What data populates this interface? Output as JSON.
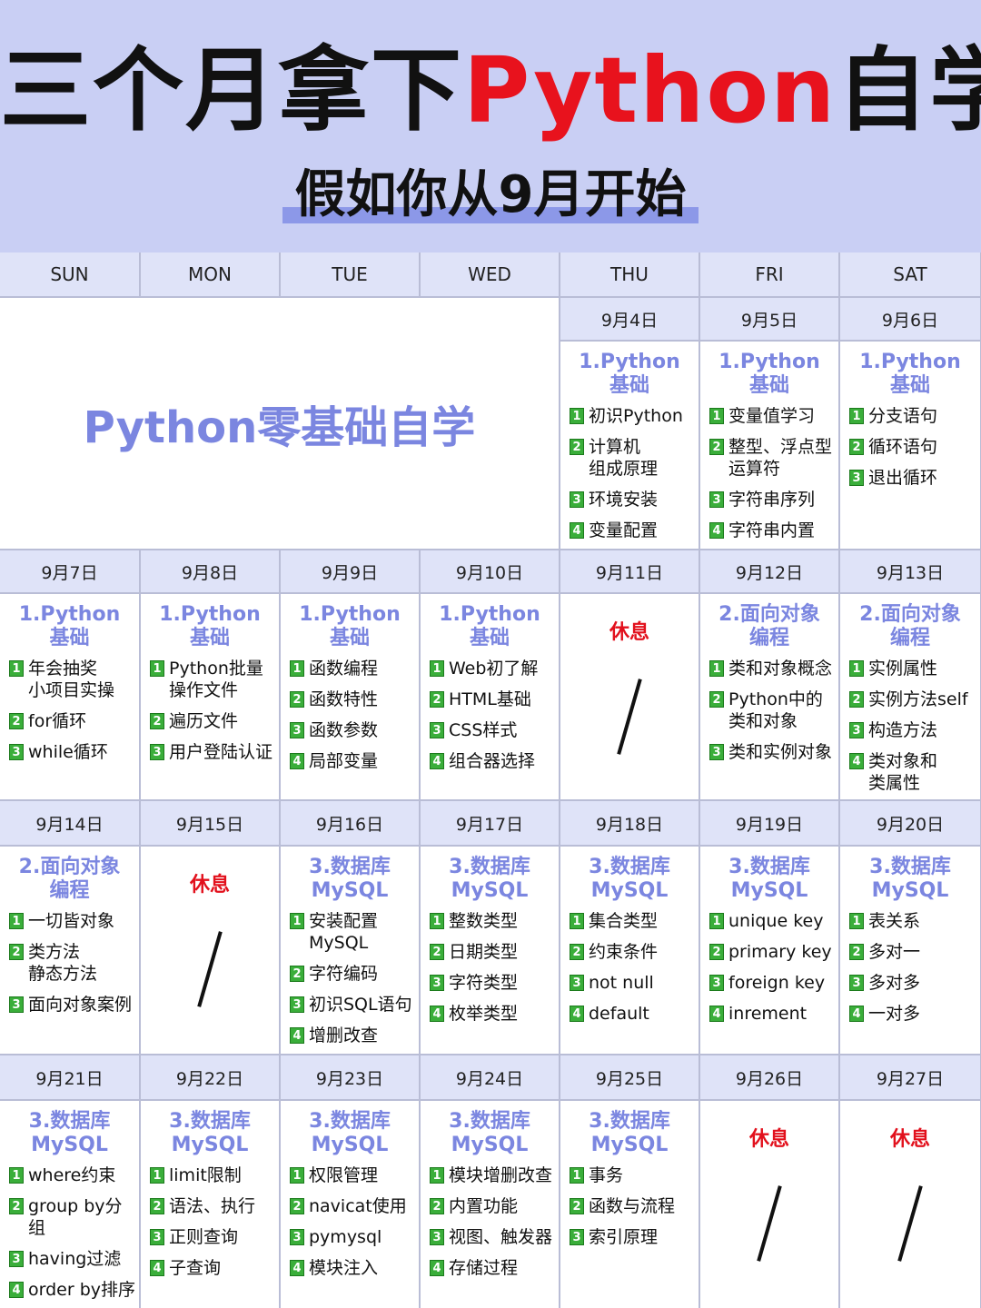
{
  "title": {
    "part1": "三个月拿下",
    "part2": "Python",
    "part3": "自学"
  },
  "subtitle": "假如你从9月开始",
  "banner": "Python零基础自学",
  "days_of_week": [
    "SUN",
    "MON",
    "TUE",
    "WED",
    "THU",
    "FRI",
    "SAT"
  ],
  "rest_label": "休息",
  "weeks": [
    {
      "cells": [
        null,
        null,
        null,
        null,
        {
          "date": "9月4日",
          "title": "1.Python\n基础",
          "items": [
            "初识Python",
            "计算机\n组成原理",
            "环境安装",
            "变量配置"
          ]
        },
        {
          "date": "9月5日",
          "title": "1.Python\n基础",
          "items": [
            "变量值学习",
            "整型、浮点型\n运算符",
            "字符串序列",
            "字符串内置"
          ]
        },
        {
          "date": "9月6日",
          "title": "1.Python\n基础",
          "items": [
            "分支语句",
            "循环语句",
            "退出循环"
          ]
        }
      ]
    },
    {
      "cells": [
        {
          "date": "9月7日",
          "title": "1.Python\n基础",
          "items": [
            "年会抽奖\n小项目实操",
            "for循环",
            "while循环"
          ]
        },
        {
          "date": "9月8日",
          "title": "1.Python\n基础",
          "items": [
            "Python批量\n操作文件",
            "遍历文件",
            "用户登陆认证"
          ]
        },
        {
          "date": "9月9日",
          "title": "1.Python\n基础",
          "items": [
            "函数编程",
            "函数特性",
            "函数参数",
            "局部变量"
          ]
        },
        {
          "date": "9月10日",
          "title": "1.Python\n基础",
          "items": [
            "Web初了解",
            "HTML基础",
            "CSS样式",
            "组合器选择"
          ]
        },
        {
          "date": "9月11日",
          "rest": true
        },
        {
          "date": "9月12日",
          "title": "2.面向对象\n编程",
          "items": [
            "类和对象概念",
            "Python中的\n类和对象",
            "类和实例对象"
          ]
        },
        {
          "date": "9月13日",
          "title": "2.面向对象\n编程",
          "items": [
            "实例属性",
            "实例方法self",
            "构造方法",
            "类对象和\n类属性"
          ]
        }
      ]
    },
    {
      "cells": [
        {
          "date": "9月14日",
          "title": "2.面向对象\n编程",
          "items": [
            "一切皆对象",
            "类方法\n静态方法",
            "面向对象案例"
          ]
        },
        {
          "date": "9月15日",
          "rest": true
        },
        {
          "date": "9月16日",
          "title": "3.数据库\nMySQL",
          "items": [
            "安装配置\nMySQL",
            "字符编码",
            "初识SQL语句",
            "增删改查"
          ]
        },
        {
          "date": "9月17日",
          "title": "3.数据库\nMySQL",
          "items": [
            "整数类型",
            "日期类型",
            "字符类型",
            "枚举类型"
          ]
        },
        {
          "date": "9月18日",
          "title": "3.数据库\nMySQL",
          "items": [
            "集合类型",
            "约束条件",
            "not null",
            "default"
          ]
        },
        {
          "date": "9月19日",
          "title": "3.数据库\nMySQL",
          "items": [
            "unique key",
            "primary key",
            "foreign key",
            "inrement"
          ]
        },
        {
          "date": "9月20日",
          "title": "3.数据库\nMySQL",
          "items": [
            "表关系",
            "多对一",
            "多对多",
            "一对多"
          ]
        }
      ]
    },
    {
      "cells": [
        {
          "date": "9月21日",
          "title": "3.数据库\nMySQL",
          "items": [
            "where约束",
            "group by分组",
            "having过滤",
            "order by排序"
          ]
        },
        {
          "date": "9月22日",
          "title": "3.数据库\nMySQL",
          "items": [
            "limit限制",
            "语法、执行",
            "正则查询",
            "子查询"
          ]
        },
        {
          "date": "9月23日",
          "title": "3.数据库\nMySQL",
          "items": [
            "权限管理",
            "navicat使用",
            "pymysql",
            "模块注入"
          ]
        },
        {
          "date": "9月24日",
          "title": "3.数据库\nMySQL",
          "items": [
            "模块增删改查",
            "内置功能",
            "视图、触发器",
            "存储过程"
          ]
        },
        {
          "date": "9月25日",
          "title": "3.数据库\nMySQL",
          "items": [
            "事务",
            "函数与流程",
            "索引原理"
          ]
        },
        {
          "date": "9月26日",
          "rest": true
        },
        {
          "date": "9月27日",
          "rest": true
        }
      ]
    }
  ]
}
